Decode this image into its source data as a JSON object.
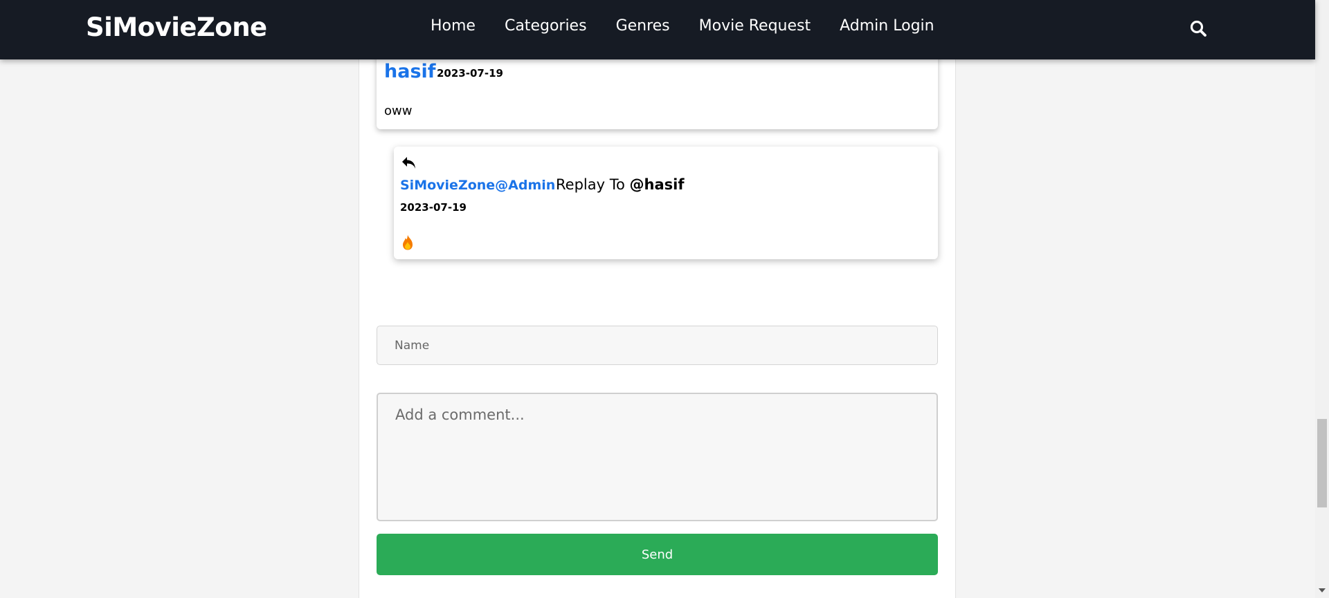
{
  "navbar": {
    "brand": "SiMovieZone",
    "links": [
      "Home",
      "Categories",
      "Genres",
      "Movie Request",
      "Admin Login"
    ],
    "search_icon": "search-icon"
  },
  "comment": {
    "author": "hasif",
    "date": "2023-07-19",
    "text": "oww"
  },
  "reply": {
    "icon": "reply-icon",
    "author": "SiMovieZone@Admin",
    "reply_prefix": "Replay To",
    "reply_target": "@hasif",
    "date": "2023-07-19",
    "text_icon": "fire-emoji"
  },
  "form": {
    "name_placeholder": "Name",
    "comment_placeholder": "Add a comment...",
    "send_label": "Send"
  },
  "colors": {
    "navbar_bg": "#161b24",
    "author_link": "#1a73e8",
    "send_button": "#2bab57"
  }
}
